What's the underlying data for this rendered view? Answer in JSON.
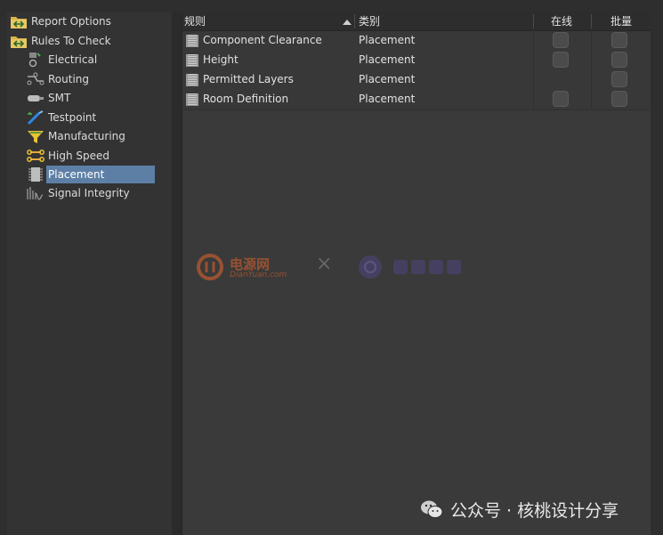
{
  "tree": {
    "items": [
      {
        "label": "Report Options",
        "icon": "folder-rules-icon",
        "level": 0
      },
      {
        "label": "Rules To Check",
        "icon": "folder-rules-icon",
        "level": 0
      },
      {
        "label": "Electrical",
        "icon": "electrical-icon",
        "level": 1
      },
      {
        "label": "Routing",
        "icon": "routing-icon",
        "level": 1
      },
      {
        "label": "SMT",
        "icon": "smt-icon",
        "level": 1
      },
      {
        "label": "Testpoint",
        "icon": "testpoint-icon",
        "level": 1
      },
      {
        "label": "Manufacturing",
        "icon": "manufacturing-icon",
        "level": 1
      },
      {
        "label": "High Speed",
        "icon": "high-speed-icon",
        "level": 1
      },
      {
        "label": "Placement",
        "icon": "placement-icon",
        "level": 1,
        "selected": true
      },
      {
        "label": "Signal Integrity",
        "icon": "signal-integrity-icon",
        "level": 1
      }
    ]
  },
  "grid": {
    "headers": {
      "rule": "规则",
      "category": "类别",
      "online": "在线",
      "batch": "批量"
    },
    "rows": [
      {
        "rule": "Component Clearance",
        "category": "Placement",
        "online_checkbox": true,
        "batch_checkbox": true
      },
      {
        "rule": "Height",
        "category": "Placement",
        "online_checkbox": true,
        "batch_checkbox": true
      },
      {
        "rule": "Permitted Layers",
        "category": "Placement",
        "online_checkbox": false,
        "batch_checkbox": true
      },
      {
        "rule": "Room Definition",
        "category": "Placement",
        "online_checkbox": true,
        "batch_checkbox": true
      }
    ]
  },
  "watermark": {
    "site_name": "电源网",
    "site_url": "DianYuan.com",
    "separator": "×"
  },
  "footer": {
    "text": "公众号 · 核桃设计分享"
  },
  "colors": {
    "selection": "#5d7fa6",
    "panel": "#333333",
    "grid_bg": "#3a3a3a"
  }
}
